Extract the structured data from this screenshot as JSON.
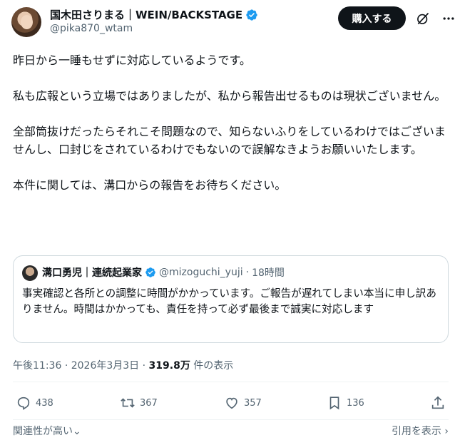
{
  "author": {
    "display_name": "国木田さりまる｜WEIN/BACKSTAGE",
    "handle": "@pika870_wtam"
  },
  "header": {
    "buy_label": "購入する"
  },
  "post": {
    "paragraphs": [
      "昨日から一睡もせずに対応しているようです。",
      "私も広報という立場ではありましたが、私から報告出せるものは現状ございません。",
      "全部筒抜けだったらそれこそ問題なので、知らないふりをしているわけではございませんし、口封じをされているわけでもないので誤解なきようお願いいたします。",
      "本件に関しては、溝口からの報告をお待ちください。"
    ]
  },
  "quote": {
    "display_name": "溝口勇児｜連続起業家",
    "handle": "@mizoguchi_yuji",
    "time": "18時間",
    "text": "事実確認と各所との調整に時間がかかっています。ご報告が遅れてしまい本当に申し訳ありません。時間はかかっても、責任を持って必ず最後まで誠実に対応します"
  },
  "meta": {
    "time": "午後11:36",
    "date": "2026年3月3日",
    "views": "319.8万",
    "views_suffix": "件の表示"
  },
  "actions": {
    "replies": "438",
    "reposts": "367",
    "likes": "357",
    "bookmarks": "136"
  },
  "footer": {
    "sort_label": "関連性が高い",
    "quotes_label": "引用を表示"
  },
  "icons": {
    "verified": "verified-badge-icon",
    "grok": "grok-icon",
    "more": "more-icon",
    "reply": "reply-icon",
    "repost": "repost-icon",
    "like": "like-icon",
    "bookmark": "bookmark-icon",
    "share": "share-icon"
  },
  "colors": {
    "verified_blue": "#1d9bf0",
    "text": "#0f1419",
    "secondary": "#536471",
    "border": "#cfd9de"
  }
}
